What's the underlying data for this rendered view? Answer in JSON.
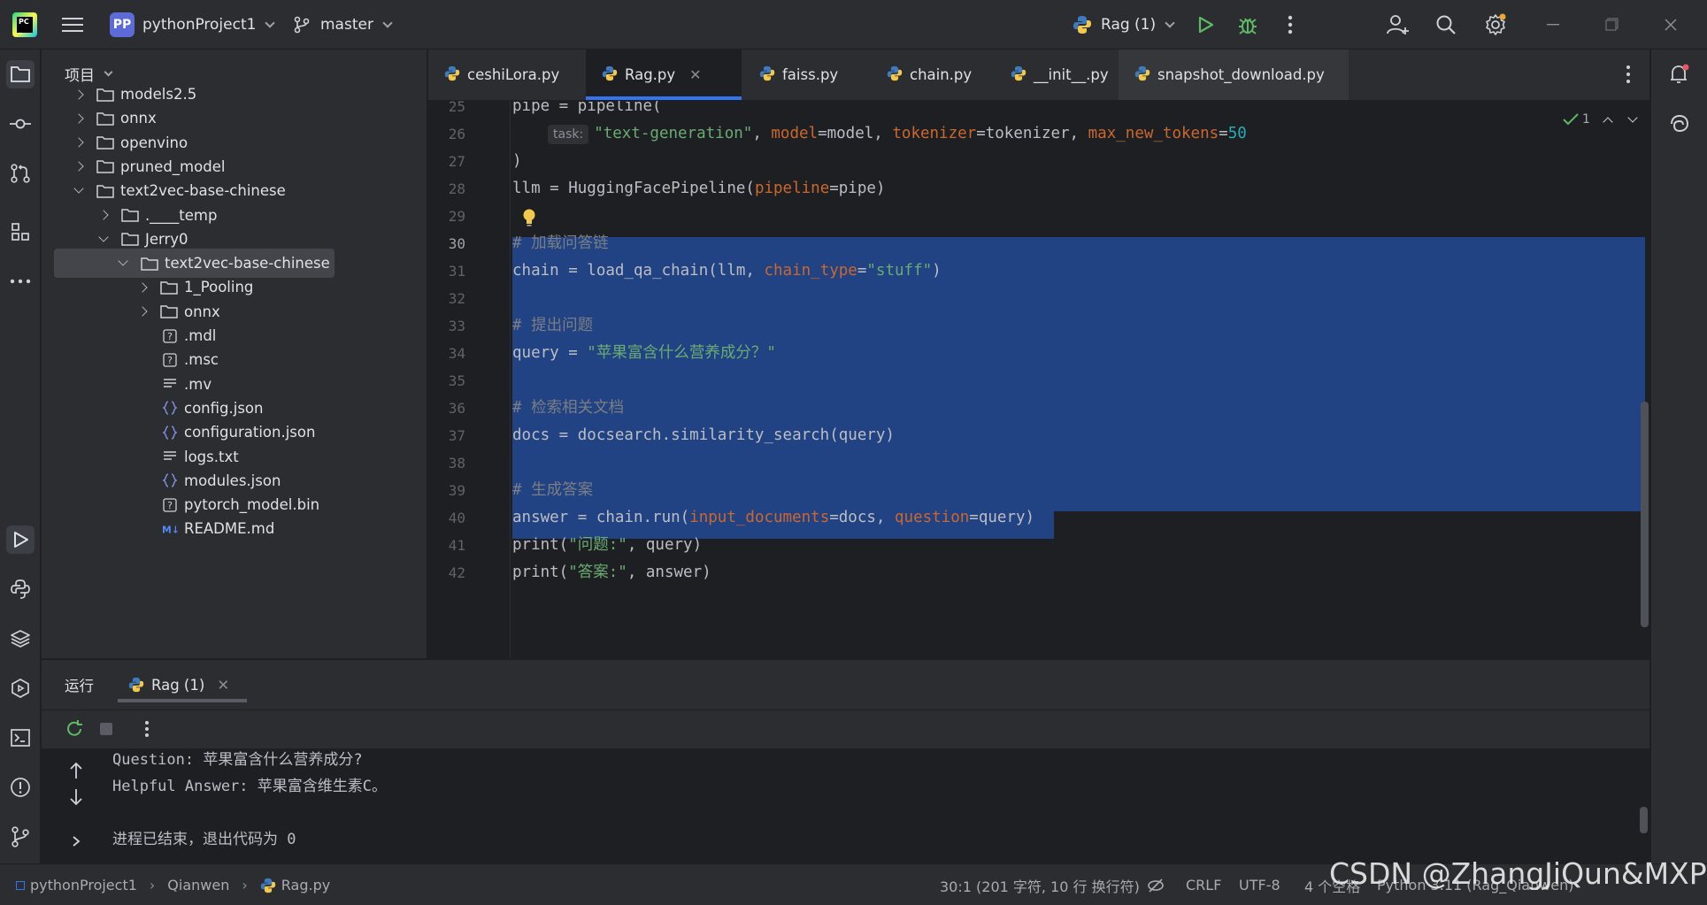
{
  "titlebar": {
    "project_badge": "PP",
    "project_name": "pythonProject1",
    "branch": "master",
    "run_config": "Rag (1)"
  },
  "project_panel": {
    "title": "项目",
    "tree": [
      {
        "label": "models2.5",
        "type": "folder",
        "state": "collapsed"
      },
      {
        "label": "onnx",
        "type": "folder",
        "state": "collapsed"
      },
      {
        "label": "openvino",
        "type": "folder",
        "state": "collapsed"
      },
      {
        "label": "pruned_model",
        "type": "folder",
        "state": "collapsed"
      },
      {
        "label": "text2vec-base-chinese",
        "type": "folder",
        "state": "expanded"
      },
      {
        "label": ".____temp",
        "type": "folder",
        "state": "collapsed"
      },
      {
        "label": "Jerry0",
        "type": "folder",
        "state": "expanded"
      },
      {
        "label": "text2vec-base-chinese",
        "type": "folder",
        "state": "expanded",
        "selected": true
      },
      {
        "label": "1_Pooling",
        "type": "folder",
        "state": "collapsed"
      },
      {
        "label": "onnx",
        "type": "folder",
        "state": "collapsed"
      },
      {
        "label": ".mdl",
        "type": "unknown"
      },
      {
        "label": ".msc",
        "type": "unknown"
      },
      {
        "label": ".mv",
        "type": "text"
      },
      {
        "label": "config.json",
        "type": "json"
      },
      {
        "label": "configuration.json",
        "type": "json"
      },
      {
        "label": "logs.txt",
        "type": "text"
      },
      {
        "label": "modules.json",
        "type": "json"
      },
      {
        "label": "pytorch_model.bin",
        "type": "unknown"
      },
      {
        "label": "README.md",
        "type": "markdown"
      }
    ]
  },
  "editor": {
    "tabs": [
      {
        "label": "ceshiLora.py",
        "active": false
      },
      {
        "label": "Rag.py",
        "active": true
      },
      {
        "label": "faiss.py",
        "active": false
      },
      {
        "label": "chain.py",
        "active": false
      },
      {
        "label": "__init__.py",
        "active": false
      },
      {
        "label": "snapshot_download.py",
        "active": false
      }
    ],
    "inspection_count": "1",
    "current_line": "30",
    "line_numbers": [
      "25",
      "26",
      "27",
      "28",
      "29",
      "30",
      "31",
      "32",
      "33",
      "34",
      "35",
      "36",
      "37",
      "38",
      "39",
      "40",
      "41",
      "42"
    ],
    "code": {
      "l25": "pipe = pipeline(",
      "l26_hint": "task:",
      "l26_a": "\"text-generation\"",
      "l26_b": ", ",
      "l26_c": "model",
      "l26_d": "=model, ",
      "l26_e": "tokenizer",
      "l26_f": "=tokenizer, ",
      "l26_g": "max_new_tokens",
      "l26_h": "=",
      "l26_i": "50",
      "l27": ")",
      "l28_a": "llm = HuggingFacePipeline(",
      "l28_b": "pipeline",
      "l28_c": "=pipe)",
      "l30": "# 加载问答链",
      "l31_a": "chain = load_qa_chain(llm, ",
      "l31_b": "chain_type",
      "l31_c": "=",
      "l31_d": "\"stuff\"",
      "l31_e": ")",
      "l33": "# 提出问题",
      "l34_a": "query = ",
      "l34_b": "\"苹果富含什么营养成分？\"",
      "l36": "# 检索相关文档",
      "l37": "docs = docsearch.similarity_search(query)",
      "l39": "# 生成答案",
      "l40_a": "answer = chain.run(",
      "l40_b": "input_documents",
      "l40_c": "=docs, ",
      "l40_d": "question",
      "l40_e": "=query)",
      "l41_a": "print(",
      "l41_b": "\"问题:\"",
      "l41_c": ", query)",
      "l42_a": "print(",
      "l42_b": "\"答案:\"",
      "l42_c": ", answer)"
    }
  },
  "run_panel": {
    "title": "运行",
    "tab_label": "Rag (1)",
    "console": [
      "Question: 苹果富含什么营养成分?",
      "Helpful Answer: 苹果富含维生素C。",
      "",
      "进程已结束，退出代码为 0"
    ]
  },
  "statusbar": {
    "crumb_project": "pythonProject1",
    "crumb_folder": "Qianwen",
    "crumb_file": "Rag.py",
    "position": "30:1 (201 字符, 10 行 换行符)",
    "line_sep": "CRLF",
    "encoding": "UTF-8",
    "indent": "4 个空格",
    "interpreter": "Python 3.11 (Rag_Qianwen)"
  },
  "watermark": "CSDN @ZhangJiQun&MXP",
  "colors": {
    "accent": "#3574f0",
    "selection": "#214283",
    "run_green": "#5fb865",
    "debug_green": "#5fb865",
    "py_blue": "#3d7abf",
    "py_yellow": "#f2c94c"
  }
}
